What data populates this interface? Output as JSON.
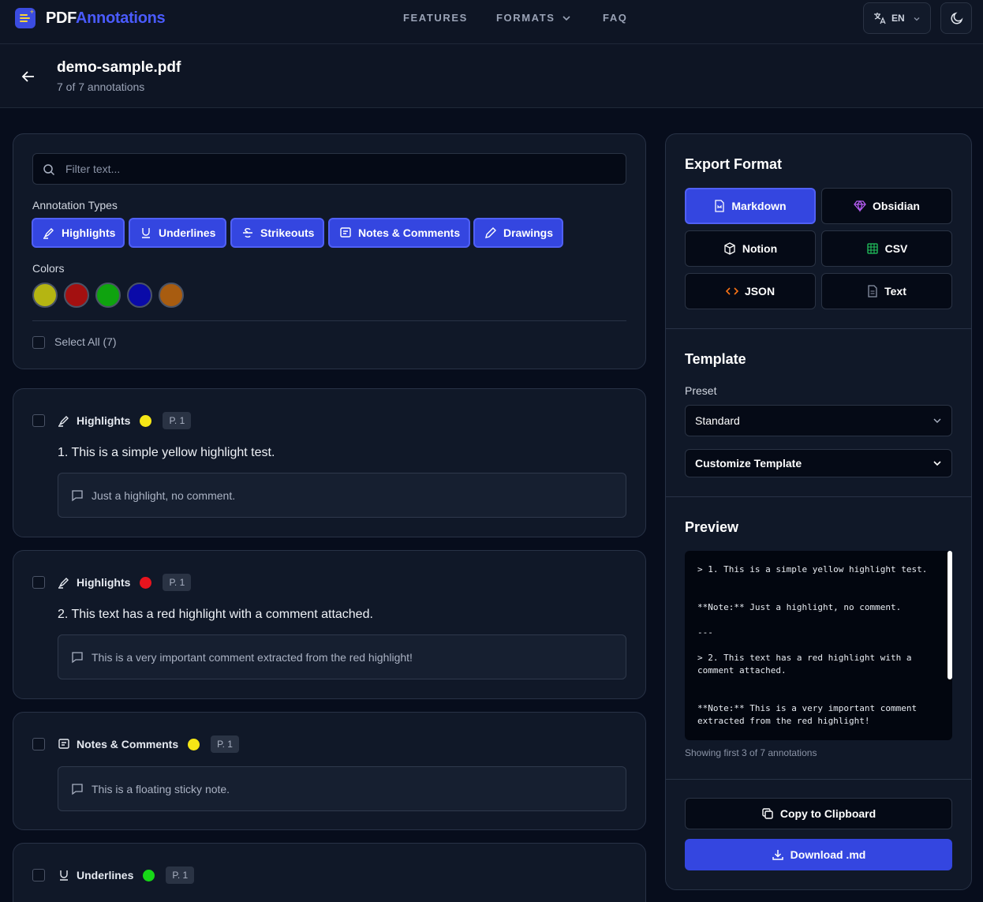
{
  "header": {
    "logo_part1": "PDF",
    "logo_part2": "Annotations",
    "nav": [
      "FEATURES",
      "FORMATS",
      "FAQ"
    ],
    "language": "EN"
  },
  "file": {
    "name": "demo-sample.pdf",
    "count_text": "7 of 7 annotations"
  },
  "filter": {
    "placeholder": "Filter text...",
    "types_label": "Annotation Types",
    "types": [
      "Highlights",
      "Underlines",
      "Strikeouts",
      "Notes & Comments",
      "Drawings"
    ],
    "colors_label": "Colors",
    "colors": [
      "#b5b512",
      "#a31010",
      "#0fa30f",
      "#0a0aa8",
      "#a85c10"
    ],
    "select_all": "Select All (7)"
  },
  "annotations": [
    {
      "type": "Highlights",
      "icon": "highlighter-icon",
      "color": "#f5e616",
      "page": "P. 1",
      "text": "1. This is a simple yellow highlight test.",
      "comment": "Just a highlight, no comment."
    },
    {
      "type": "Highlights",
      "icon": "highlighter-icon",
      "color": "#e8141e",
      "page": "P. 1",
      "text": "2. This text has a red highlight with a comment attached.",
      "comment": "This is a very important comment extracted from the red highlight!"
    },
    {
      "type": "Notes & Comments",
      "icon": "note-icon",
      "color": "#f5e616",
      "page": "P. 1",
      "comment": "This is a floating sticky note."
    },
    {
      "type": "Underlines",
      "icon": "underline-icon",
      "color": "#17d817",
      "page": "P. 1"
    }
  ],
  "export": {
    "title": "Export Format",
    "formats": [
      "Markdown",
      "Obsidian",
      "Notion",
      "CSV",
      "JSON",
      "Text"
    ]
  },
  "template": {
    "title": "Template",
    "preset_label": "Preset",
    "preset_value": "Standard",
    "customize": "Customize Template"
  },
  "preview": {
    "title": "Preview",
    "content": "> 1. This is a simple yellow highlight test.\n\n\n**Note:** Just a highlight, no comment.\n\n---\n\n> 2. This text has a red highlight with a\ncomment attached.\n\n\n**Note:** This is a very important comment\nextracted from the red highlight!",
    "footer": "Showing first 3 of 7 annotations"
  },
  "actions": {
    "copy": "Copy to Clipboard",
    "download": "Download .md"
  }
}
